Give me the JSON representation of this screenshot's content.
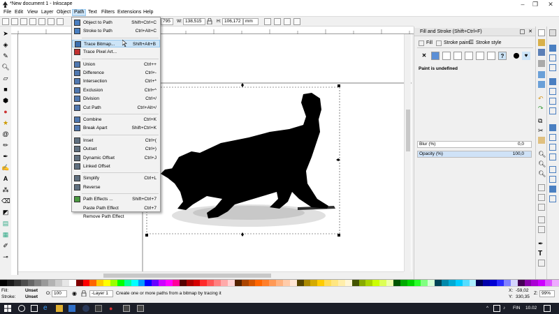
{
  "window": {
    "title": "*New document 1 - Inkscape",
    "controls": [
      "–",
      "❐",
      "✕"
    ]
  },
  "menubar": [
    "File",
    "Edit",
    "View",
    "Layer",
    "Object",
    "Path",
    "Text",
    "Filters",
    "Extensions",
    "Help"
  ],
  "command_bar": {
    "x_value": "795",
    "w_label": "W:",
    "w_value": "138,515",
    "h_label": "H:",
    "h_value": "106,172",
    "unit": "mm"
  },
  "path_menu": {
    "items": [
      {
        "label": "Object to Path",
        "shortcut": "Shift+Ctrl+C",
        "icon": "object-to-path-icon",
        "color": "#4a7fc1"
      },
      {
        "label": "Stroke to Path",
        "shortcut": "Ctrl+Alt+C",
        "icon": "stroke-to-path-icon",
        "color": "#4a7fc1"
      },
      {
        "label": "Trace Bitmap...",
        "shortcut": "Shift+Alt+B",
        "icon": "trace-bitmap-icon",
        "color": "#3b6fb0"
      },
      {
        "label": "Trace Pixel Art...",
        "shortcut": "",
        "icon": "trace-pixel-art-icon",
        "color": "#c03030"
      },
      {
        "label": "Union",
        "shortcut": "Ctrl++",
        "icon": "union-icon",
        "color": "#5078b0"
      },
      {
        "label": "Difference",
        "shortcut": "Ctrl+-",
        "icon": "difference-icon",
        "color": "#5078b0"
      },
      {
        "label": "Intersection",
        "shortcut": "Ctrl+*",
        "icon": "intersection-icon",
        "color": "#5078b0"
      },
      {
        "label": "Exclusion",
        "shortcut": "Ctrl+^",
        "icon": "exclusion-icon",
        "color": "#5078b0"
      },
      {
        "label": "Division",
        "shortcut": "Ctrl+/",
        "icon": "division-icon",
        "color": "#5078b0"
      },
      {
        "label": "Cut Path",
        "shortcut": "Ctrl+Alt+/",
        "icon": "cut-path-icon",
        "color": "#5078b0"
      },
      {
        "label": "Combine",
        "shortcut": "Ctrl+K",
        "icon": "combine-icon",
        "color": "#5078b0"
      },
      {
        "label": "Break Apart",
        "shortcut": "Shift+Ctrl+K",
        "icon": "break-apart-icon",
        "color": "#5078b0"
      },
      {
        "label": "Inset",
        "shortcut": "Ctrl+(",
        "icon": "inset-icon",
        "color": "#607080"
      },
      {
        "label": "Outset",
        "shortcut": "Ctrl+)",
        "icon": "outset-icon",
        "color": "#607080"
      },
      {
        "label": "Dynamic Offset",
        "shortcut": "Ctrl+J",
        "icon": "dynamic-offset-icon",
        "color": "#607080"
      },
      {
        "label": "Linked Offset",
        "shortcut": "",
        "icon": "linked-offset-icon",
        "color": "#607080"
      },
      {
        "label": "Simplify",
        "shortcut": "Ctrl+L",
        "icon": "simplify-icon",
        "color": "#607080"
      },
      {
        "label": "Reverse",
        "shortcut": "",
        "icon": "reverse-icon",
        "color": "#607080"
      },
      {
        "label": "Path Effects ...",
        "shortcut": "Shift+Ctrl+7",
        "icon": "path-effects-icon",
        "color": "#4a9a40"
      },
      {
        "label": "Paste Path Effect",
        "shortcut": "Ctrl+7",
        "icon": "",
        "color": ""
      },
      {
        "label": "Remove Path Effect",
        "shortcut": "",
        "icon": "",
        "color": ""
      }
    ],
    "highlighted": "Trace Bitmap..."
  },
  "fill_stroke": {
    "title": "Fill and Stroke (Shift+Ctrl+F)",
    "tabs": [
      "Fill",
      "Stroke paint",
      "Stroke style"
    ],
    "status": "Paint is undefined",
    "blur_label": "Blur (%)",
    "blur_value": "0,0",
    "opacity_label": "Opacity (%)",
    "opacity_value": "100,0"
  },
  "status": {
    "fill_label": "Fill:",
    "fill_value": "Unset",
    "stroke_label": "Stroke:",
    "stroke_value": "Unset",
    "opacity_label": "O:",
    "opacity_value": "100",
    "layer": "-Layer 1",
    "message": "Create one or more paths from a bitmap by tracing it",
    "x_label": "X:",
    "x_value": "-59,02",
    "y_label": "Y:",
    "y_value": "330,35",
    "zoom_label": "Z:",
    "zoom_value": "99%"
  },
  "taskbar": {
    "lang": "FIN",
    "time": "10.02"
  },
  "colors": {
    "menu_highlight": "#cce4f7",
    "accent": "#3b6fb0"
  }
}
